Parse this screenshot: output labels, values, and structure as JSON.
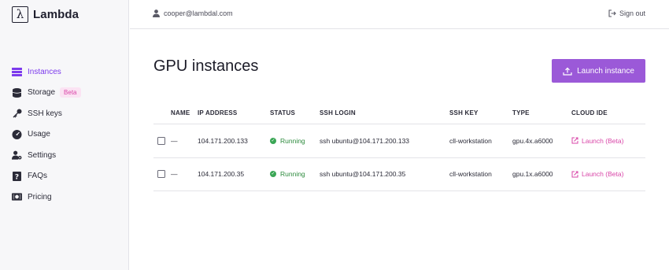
{
  "brand": {
    "logo_glyph": "λ",
    "name": "Lambda"
  },
  "sidebar": {
    "items": [
      {
        "label": "Instances",
        "icon": "instances-icon",
        "active": true
      },
      {
        "label": "Storage",
        "icon": "storage-icon",
        "badge": "Beta"
      },
      {
        "label": "SSH keys",
        "icon": "key-icon"
      },
      {
        "label": "Usage",
        "icon": "gauge-icon"
      },
      {
        "label": "Settings",
        "icon": "user-settings-icon"
      },
      {
        "label": "FAQs",
        "icon": "question-icon"
      },
      {
        "label": "Pricing",
        "icon": "money-icon"
      }
    ]
  },
  "header": {
    "user_email": "cooper@lambdal.com",
    "sign_out": "Sign out"
  },
  "main": {
    "title": "GPU instances",
    "launch_label": "Launch instance",
    "columns": [
      "NAME",
      "IP ADDRESS",
      "STATUS",
      "SSH LOGIN",
      "SSH KEY",
      "TYPE",
      "CLOUD IDE"
    ],
    "rows": [
      {
        "name": "—",
        "ip": "104.171.200.133",
        "status": "Running",
        "ssh_login": "ssh ubuntu@104.171.200.133",
        "ssh_key": "cll-workstation",
        "type": "gpu.4x.a6000",
        "ide": "Launch (Beta)"
      },
      {
        "name": "—",
        "ip": "104.171.200.35",
        "status": "Running",
        "ssh_login": "ssh ubuntu@104.171.200.35",
        "ssh_key": "cll-workstation",
        "type": "gpu.1x.a6000",
        "ide": "Launch (Beta)"
      }
    ]
  },
  "colors": {
    "accent": "#9b59d8",
    "active_nav": "#7c3aed",
    "running": "#3aa655",
    "ide_link": "#d946a8"
  }
}
